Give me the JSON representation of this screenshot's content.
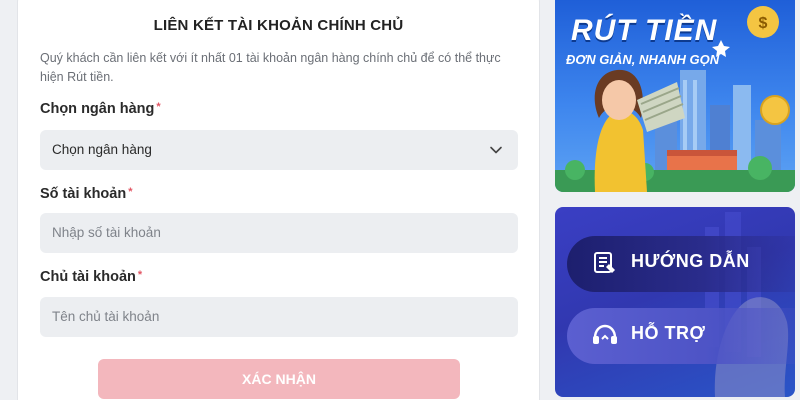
{
  "form": {
    "title": "LIÊN KẾT TÀI KHOẢN CHÍNH CHỦ",
    "description": "Quý khách cần liên kết với ít nhất 01 tài khoản ngân hàng chính chủ để có thể thực hiện Rút tiền.",
    "required_marker": "*",
    "bank": {
      "label": "Chọn ngân hàng",
      "selected": "Chọn ngân hàng"
    },
    "account_number": {
      "label": "Số tài khoản",
      "placeholder": "Nhập số tài khoản"
    },
    "account_holder": {
      "label": "Chủ tài khoản",
      "placeholder": "Tên chủ tài khoản"
    },
    "submit_label": "XÁC NHẬN"
  },
  "promo": {
    "title": "RÚT TIỀN",
    "subtitle": "ĐƠN GIẢN, NHANH GỌN"
  },
  "help": {
    "guide_label": "HƯỚNG DẪN",
    "support_label": "HỖ TRỢ"
  },
  "icons": {
    "chevron": "chevron-down-icon",
    "guide": "guide-book-icon",
    "support": "headset-icon",
    "money_bag": "money-bag-icon"
  },
  "colors": {
    "submit_disabled": "#f3b7bd",
    "required": "#e25563",
    "field_bg": "#eceef1",
    "promo_bg": "#2f74e6",
    "help_bg": "#3338b6"
  }
}
